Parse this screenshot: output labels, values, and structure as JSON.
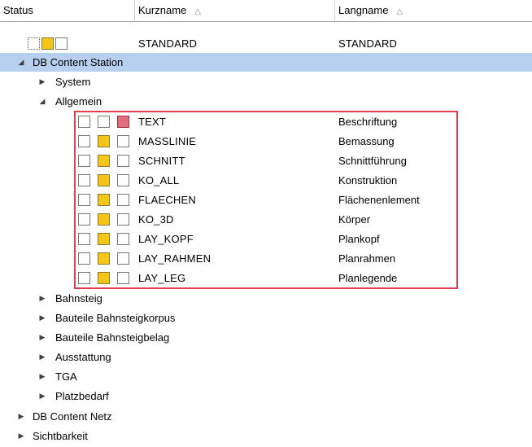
{
  "header": {
    "status": "Status",
    "kurzname": "Kurzname",
    "langname": "Langname",
    "sort_glyph": "△"
  },
  "colors": {
    "selection": "#b8d0f0",
    "yellow": "#f5c518",
    "red": "#e07080",
    "highlight_border": "#e04050"
  },
  "tree": {
    "standard": {
      "kurz": "STANDARD",
      "lang": "STANDARD"
    },
    "db_content_station": "DB Content Station",
    "system": "System",
    "allgemein": "Allgemein",
    "layers": [
      {
        "kurz": "TEXT",
        "lang": "Beschriftung"
      },
      {
        "kurz": "MASSLINIE",
        "lang": "Bemassung"
      },
      {
        "kurz": "SCHNITT",
        "lang": "Schnittführung"
      },
      {
        "kurz": "KO_ALL",
        "lang": "Konstruktion"
      },
      {
        "kurz": "FLAECHEN",
        "lang": "Flächenenlement"
      },
      {
        "kurz": "KO_3D",
        "lang": "Körper"
      },
      {
        "kurz": "LAY_KOPF",
        "lang": "Plankopf"
      },
      {
        "kurz": "LAY_RAHMEN",
        "lang": "Planrahmen"
      },
      {
        "kurz": "LAY_LEG",
        "lang": "Planlegende"
      }
    ],
    "bahnsteig": "Bahnsteig",
    "bauteile_korpus": "Bauteile Bahnsteigkorpus",
    "bauteile_belag": "Bauteile Bahnsteigbelag",
    "ausstattung": "Ausstattung",
    "tga": "TGA",
    "platzbedarf": "Platzbedarf",
    "db_content_netz": "DB Content Netz",
    "sichtbarkeit": "Sichtbarkeit"
  },
  "icons": {
    "collapsed": "▶",
    "expanded": "◢"
  }
}
